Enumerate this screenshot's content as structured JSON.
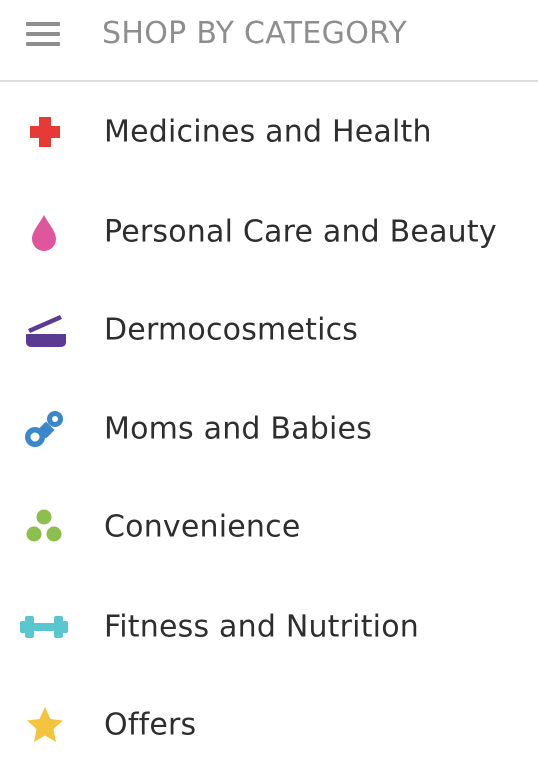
{
  "header": {
    "title": "SHOP BY CATEGORY",
    "menu_icon": "hamburger-menu-icon"
  },
  "categories": [
    {
      "label": "Medicines and Health",
      "icon": "red-cross-icon",
      "color": "#e53a35"
    },
    {
      "label": "Personal Care and Beauty",
      "icon": "drop-icon",
      "color": "#e0569c"
    },
    {
      "label": "Dermocosmetics",
      "icon": "cream-jar-icon",
      "color": "#5b3a94"
    },
    {
      "label": "Moms and Babies",
      "icon": "pacifier-icon",
      "color": "#3a87c9"
    },
    {
      "label": "Convenience",
      "icon": "three-dots-icon",
      "color": "#8cbf4d"
    },
    {
      "label": "Fitness and Nutrition",
      "icon": "dumbbell-icon",
      "color": "#5ac6cf"
    },
    {
      "label": "Offers",
      "icon": "star-icon",
      "color": "#f4c43f"
    }
  ]
}
